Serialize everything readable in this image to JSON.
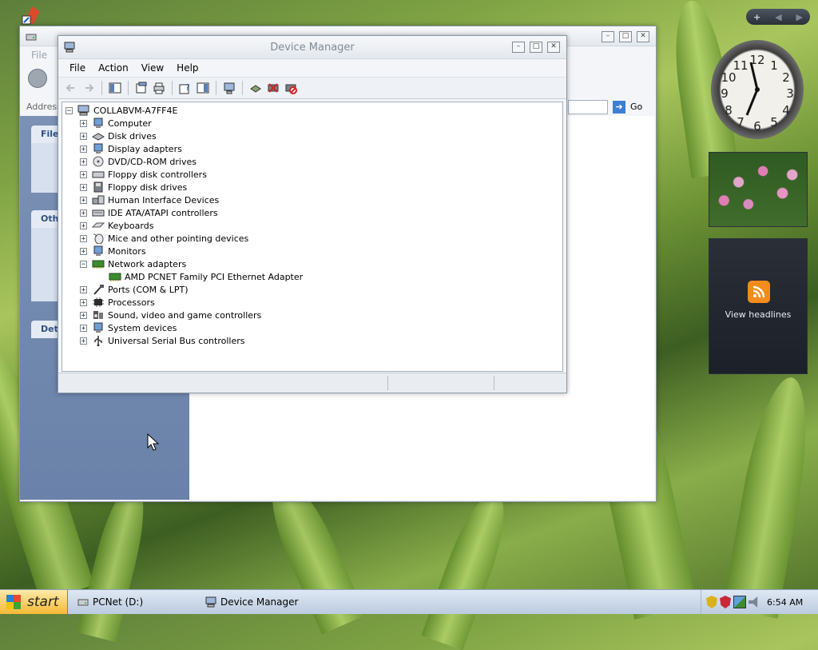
{
  "desktop": {
    "gadget_bar_controls": [
      "+",
      "◀",
      "▶"
    ],
    "feed_gadget": {
      "label": "View headlines"
    }
  },
  "explorer_window": {
    "menu": [
      "File"
    ],
    "address_label": "Address",
    "go_label": "Go",
    "panes": [
      {
        "label": "File"
      },
      {
        "label": "Oth"
      },
      {
        "label": "Det"
      }
    ]
  },
  "device_manager": {
    "title": "Device Manager",
    "menu": [
      "File",
      "Action",
      "View",
      "Help"
    ],
    "tree": {
      "root": "COLLABVM-A7FF4E",
      "categories": [
        {
          "label": "Computer",
          "expanded": false,
          "icon": "computer-icon"
        },
        {
          "label": "Disk drives",
          "expanded": false,
          "icon": "disk-icon"
        },
        {
          "label": "Display adapters",
          "expanded": false,
          "icon": "display-icon"
        },
        {
          "label": "DVD/CD-ROM drives",
          "expanded": false,
          "icon": "cdrom-icon"
        },
        {
          "label": "Floppy disk controllers",
          "expanded": false,
          "icon": "controller-icon"
        },
        {
          "label": "Floppy disk drives",
          "expanded": false,
          "icon": "floppy-icon"
        },
        {
          "label": "Human Interface Devices",
          "expanded": false,
          "icon": "hid-icon"
        },
        {
          "label": "IDE ATA/ATAPI controllers",
          "expanded": false,
          "icon": "ide-icon"
        },
        {
          "label": "Keyboards",
          "expanded": false,
          "icon": "keyboard-icon"
        },
        {
          "label": "Mice and other pointing devices",
          "expanded": false,
          "icon": "mouse-icon"
        },
        {
          "label": "Monitors",
          "expanded": false,
          "icon": "monitor-icon"
        },
        {
          "label": "Network adapters",
          "expanded": true,
          "icon": "network-icon",
          "children": [
            "AMD PCNET Family PCI Ethernet Adapter"
          ]
        },
        {
          "label": "Ports (COM & LPT)",
          "expanded": false,
          "icon": "port-icon"
        },
        {
          "label": "Processors",
          "expanded": false,
          "icon": "processor-icon"
        },
        {
          "label": "Sound, video and game controllers",
          "expanded": false,
          "icon": "sound-icon"
        },
        {
          "label": "System devices",
          "expanded": false,
          "icon": "system-icon"
        },
        {
          "label": "Universal Serial Bus controllers",
          "expanded": false,
          "icon": "usb-icon"
        }
      ]
    }
  },
  "taskbar": {
    "start_label": "start",
    "items": [
      "PCNet (D:)",
      "Device Manager"
    ],
    "clock": "6:54 AM"
  },
  "colors": {
    "accent": "#3d7fd4",
    "start": "#f5b935",
    "feed": "#f28c1a"
  }
}
